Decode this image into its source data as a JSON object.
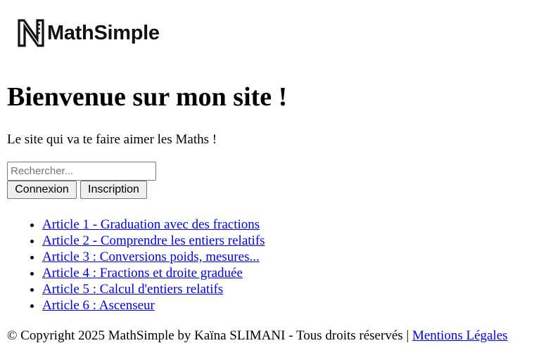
{
  "logo": {
    "text": "MathSimple",
    "icon": "ruler-n-logo-icon"
  },
  "hero": {
    "title": "Bienvenue sur mon site !",
    "tagline": "Le site qui va te faire aimer les Maths !"
  },
  "search": {
    "placeholder": "Rechercher..."
  },
  "auth": {
    "login_label": "Connexion",
    "signup_label": "Inscription"
  },
  "articles": [
    {
      "label": "Article 1 - Graduation avec des fractions"
    },
    {
      "label": "Article 2 - Comprendre les entiers relatifs"
    },
    {
      "label": "Article 3 : Conversions poids, mesures..."
    },
    {
      "label": "Article 4 : Fractions et droite graduée"
    },
    {
      "label": "Article 5 : Calcul d'entiers relatifs"
    },
    {
      "label": "Article 6 : Ascenseur"
    }
  ],
  "footer": {
    "copyright": "© Copyright 2025 MathSimple by Kaïna SLIMANI - Tous droits réservés | ",
    "legal_link": "Mentions Légales"
  },
  "colors": {
    "link": "#0000ee",
    "text": "#000000",
    "background": "#ffffff"
  }
}
